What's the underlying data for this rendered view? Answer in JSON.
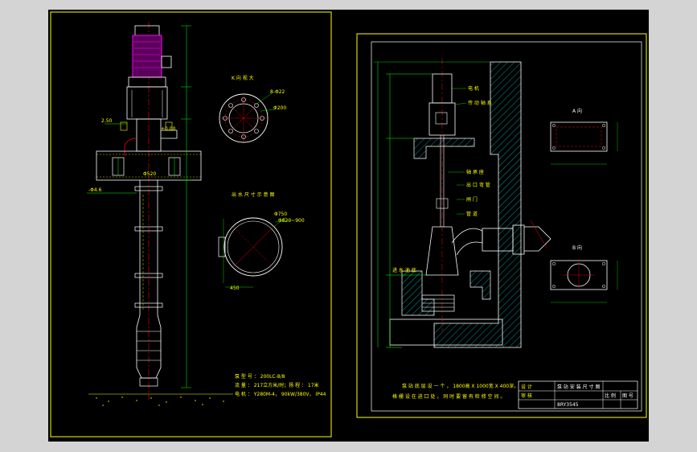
{
  "left_sheet": {
    "view_k_label": "K 向 视 大",
    "view_k_dims": [
      "8-Φ22",
      "Φ200"
    ],
    "section_label": "出 水 尺 寸 示 意 图",
    "section_dims": [
      "Φ750",
      "Φ820~900",
      "450"
    ],
    "left_dims": [
      "2.50",
      "+0.00",
      "Φ520",
      "-Φ4.6"
    ],
    "spec_line1": "泵 型 号 ： 200LC-8/8",
    "spec_line2": "流 量 ： 217立方米/时；扬 程 ： 17米",
    "spec_line3": "电 机 ： Y280M-4， 90kW/380V， IP44"
  },
  "right_sheet": {
    "callouts": [
      "电 机",
      "传 动 轴 系",
      "轴 承 座",
      "出 口 弯 管",
      "闸 门",
      "管 道"
    ],
    "left_label": "进 水 池 底",
    "view_a_label": "A 向",
    "view_b_label": "B 向",
    "note1": "泵 站 底 层 设 一 个 ，  1800高 X 1000宽 X 400深，",
    "note2": "格 栅 设 在 进 口 处 ， 同 时 要 留 有 检 修 空 间 。",
    "title_block": {
      "title": "泵 站 安 装 尺 寸 图",
      "drawing_no": "8RY3545",
      "cells": [
        "设 计",
        "审 核",
        "比 例",
        "图 号"
      ]
    }
  },
  "colors": {
    "background": "#000000",
    "border": "#ffff00",
    "motor": "#ff00ff",
    "outline": "#ffffff",
    "dimension": "#00ff00",
    "centerline": "#ff0000",
    "hatch": "#00ffff"
  }
}
